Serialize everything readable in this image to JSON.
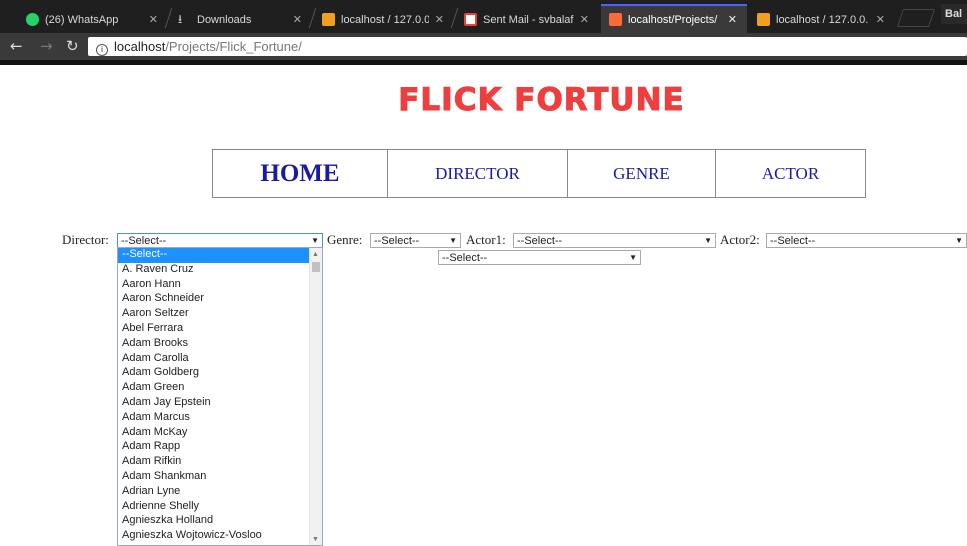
{
  "browser": {
    "tabs": [
      {
        "title": "(26) WhatsApp",
        "icon": "whatsapp-icon",
        "color": "#25d366"
      },
      {
        "title": "Downloads",
        "icon": "download-icon",
        "color": "#cccccc"
      },
      {
        "title": "localhost / 127.0.0.",
        "icon": "phpmyadmin-icon",
        "color": "#f0a020"
      },
      {
        "title": "Sent Mail - svbalaf",
        "icon": "gmail-icon",
        "color": "#ea4335"
      },
      {
        "title": "localhost/Projects/",
        "icon": "page-favicon-icon",
        "color": "#ff6a3a"
      },
      {
        "title": "localhost / 127.0.0.",
        "icon": "phpmyadmin-icon",
        "color": "#f0a020"
      }
    ],
    "profile": "Bal",
    "url_host": "localhost",
    "url_path": "/Projects/Flick_Fortune/"
  },
  "site": {
    "logo": "FLICK FORTUNE",
    "nav": [
      "HOME",
      "DIRECTOR",
      "GENRE",
      "ACTOR"
    ]
  },
  "filters": {
    "director_label": "Director:",
    "genre_label": "Genre:",
    "actor1_label": "Actor1:",
    "actor2_label": "Actor2:",
    "director_value": "--Select--",
    "genre_value": "--Select--",
    "actor1_value": "--Select--",
    "actor2_value": "--Select--",
    "extra_value": "--Select--"
  },
  "director_options": [
    "--Select--",
    "A. Raven Cruz",
    "Aaron Hann",
    "Aaron Schneider",
    "Aaron Seltzer",
    "Abel Ferrara",
    "Adam Brooks",
    "Adam Carolla",
    "Adam Goldberg",
    "Adam Green",
    "Adam Jay Epstein",
    "Adam Marcus",
    "Adam McKay",
    "Adam Rapp",
    "Adam Rifkin",
    "Adam Shankman",
    "Adrian Lyne",
    "Adrienne Shelly",
    "Agnieszka Holland",
    "Agnieszka Wojtowicz-Vosloo"
  ]
}
